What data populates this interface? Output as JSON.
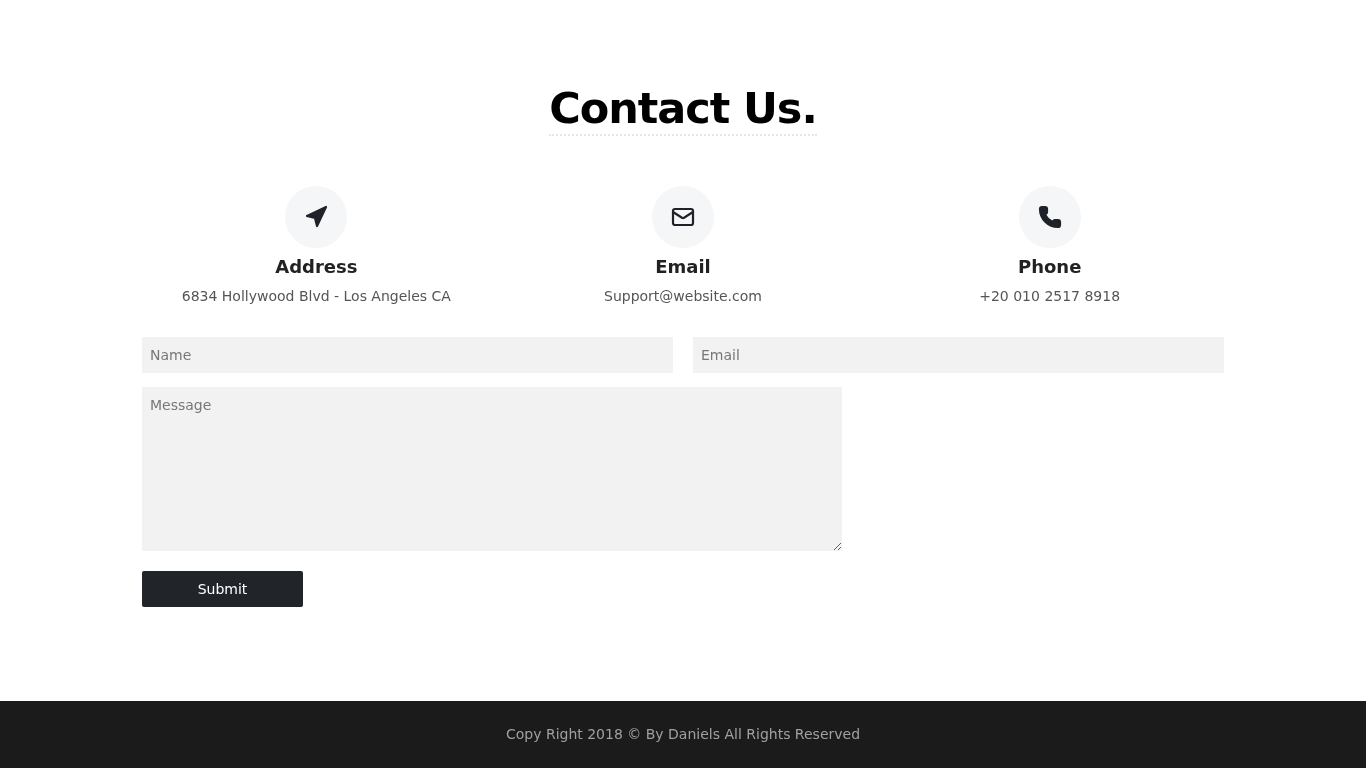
{
  "heading": "Contact Us.",
  "info": [
    {
      "kind": "location",
      "title": "Address",
      "text": "6834 Hollywood Blvd - Los Angeles CA"
    },
    {
      "kind": "email",
      "title": "Email",
      "text": "Support@website.com"
    },
    {
      "kind": "phone",
      "title": "Phone",
      "text": "+20 010 2517 8918"
    }
  ],
  "form": {
    "name": {
      "placeholder": "Name"
    },
    "email": {
      "placeholder": "Email"
    },
    "message": {
      "placeholder": "Message"
    },
    "submit": "Submit"
  },
  "footer": "Copy Right 2018 © By Daniels All Rights Reserved"
}
